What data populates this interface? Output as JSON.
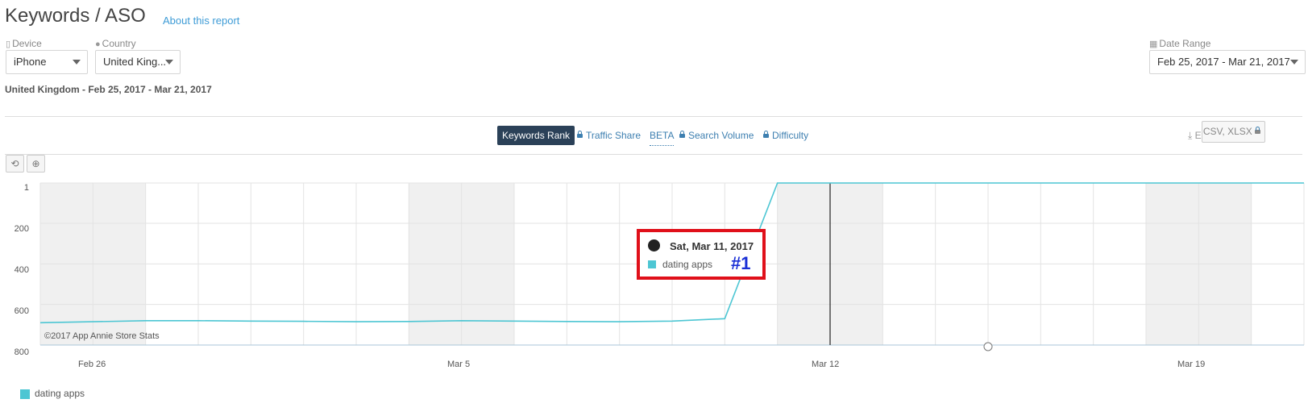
{
  "header": {
    "title": "Keywords / ASO",
    "about_link": "About this report"
  },
  "filters": {
    "device": {
      "label": "Device",
      "value": "iPhone"
    },
    "country": {
      "label": "Country",
      "value": "United King..."
    },
    "date_range": {
      "label": "Date Range",
      "value": "Feb 25, 2017 - Mar 21, 2017"
    }
  },
  "subtitle": "United Kingdom - Feb 25, 2017 - Mar 21, 2017",
  "tabs": {
    "keywords_rank": "Keywords Rank",
    "traffic_share": "Traffic Share",
    "beta": "BETA",
    "search_volume": "Search Volume",
    "difficulty": "Difficulty"
  },
  "export": {
    "label": "Export",
    "formats": "CSV, XLSX"
  },
  "chart_tools": {
    "reset": "⟲",
    "zoom": "⊕"
  },
  "chart": {
    "copyright": "©2017 App Annie Store Stats",
    "tooltip": {
      "date": "Sat, Mar 11, 2017",
      "series": "dating apps",
      "rank": "#1"
    },
    "legend": "dating apps"
  },
  "colors": {
    "series": "#4dc6d3",
    "highlight": "#e0101a",
    "rank_label": "#1a2fd6",
    "active_tab": "#2b4158"
  },
  "chart_data": {
    "type": "line",
    "title": "",
    "xlabel": "",
    "ylabel": "",
    "y_reversed": true,
    "ylim": [
      800,
      1
    ],
    "yticks": [
      "1",
      "200",
      "400",
      "600",
      "800"
    ],
    "xticks": [
      "Feb 26",
      "Mar 5",
      "Mar 12",
      "Mar 19"
    ],
    "x": [
      "Feb 25",
      "Feb 26",
      "Feb 27",
      "Feb 28",
      "Mar 1",
      "Mar 2",
      "Mar 3",
      "Mar 4",
      "Mar 5",
      "Mar 6",
      "Mar 7",
      "Mar 8",
      "Mar 9",
      "Mar 10",
      "Mar 11",
      "Mar 12",
      "Mar 13",
      "Mar 14",
      "Mar 15",
      "Mar 16",
      "Mar 17",
      "Mar 18",
      "Mar 19",
      "Mar 20",
      "Mar 21"
    ],
    "series": [
      {
        "name": "dating apps",
        "values": [
          690,
          685,
          680,
          680,
          682,
          683,
          685,
          684,
          680,
          682,
          684,
          685,
          682,
          670,
          1,
          1,
          1,
          1,
          1,
          1,
          1,
          1,
          1,
          1,
          1
        ]
      }
    ],
    "grid": true,
    "legend_position": "bottom-left"
  }
}
